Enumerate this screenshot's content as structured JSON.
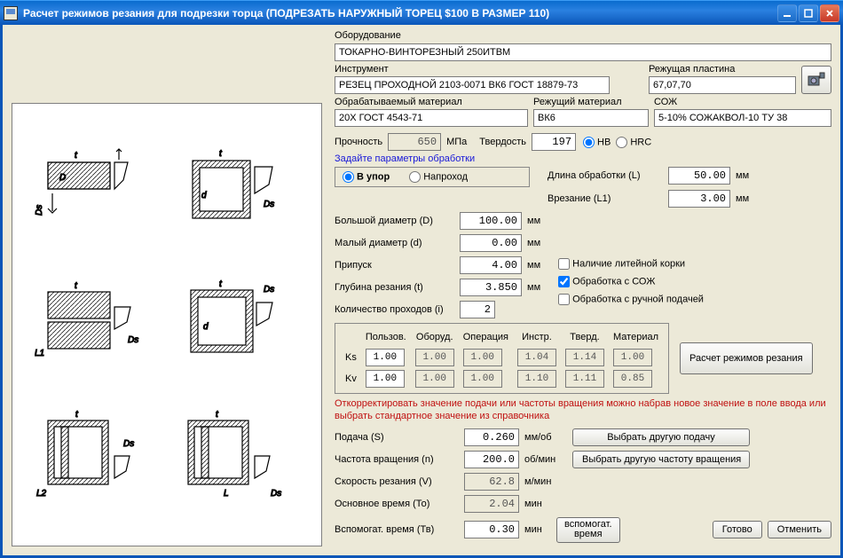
{
  "window": {
    "title": "Расчет режимов резания для подрезки торца (ПОДРЕЗАТЬ НАРУЖНЫЙ ТОРЕЦ  $100   В РАЗМЕР 110)"
  },
  "labels": {
    "equipment": "Оборудование",
    "tool": "Инструмент",
    "insert": "Режущая пластина",
    "work_material": "Обрабатываемый материал",
    "cut_material": "Режущий материал",
    "coolant": "СОЖ",
    "strength": "Прочность",
    "strength_unit": "МПа",
    "hardness": "Твердость",
    "hb": "HB",
    "hrc": "HRC",
    "set_params": "Задайте параметры обработки",
    "vupor": "В упор",
    "naprohod": "Напроход",
    "length": "Длина обработки (L)",
    "plunge": "Врезание  (L1)",
    "bigdia": "Большой диаметр (D)",
    "smalldia": "Малый диаметр (d)",
    "allowance": "Припуск",
    "depth": "Глубина резания (t)",
    "passes": "Количество проходов (i)",
    "casting_crust": "Наличие литейной корки",
    "with_coolant": "Обработка с СОЖ",
    "manual_feed": "Обработка с ручной подачей",
    "mm": "мм",
    "polzov": "Пользов.",
    "oborud": "Оборуд.",
    "operacia": "Операция",
    "instr": "Инстр.",
    "tverd": "Тверд.",
    "material": "Материал",
    "ks": "Ks",
    "kv": "Kv",
    "calc": "Расчет режимов резания",
    "note": "Откорректировать значение подачи или частоты вращения можно набрав новое значение в поле ввода или выбрать стандартное значение из справочника",
    "feed": "Подача (S)",
    "feed_unit": "мм/об",
    "rpm": "Частота вращения (n)",
    "rpm_unit": "об/мин",
    "speed": "Скорость резания (V)",
    "speed_unit": "м/мин",
    "t_main": "Основное время (То)",
    "t_aux": "Вспомогат. время (Тв)",
    "min": "мин",
    "sel_feed": "Выбрать другую подачу",
    "sel_rpm": "Выбрать другую частоту вращения",
    "aux_time_btn": "вспомогат.\nвремя",
    "done": "Готово",
    "cancel": "Отменить"
  },
  "values": {
    "equipment": "ТОКАРНО-ВИНТОРЕЗНЫЙ 250ИТВМ",
    "tool": "РЕЗЕЦ ПРОХОДНОЙ 2103-0071 ВК6 ГОСТ 18879-73",
    "insert": "67,07,70",
    "work_material": "20Х ГОСТ 4543-71",
    "cut_material": "ВК6",
    "coolant": "5-10% СОЖАКВОЛ-10 ТУ 38",
    "strength": "650",
    "hardness": "197",
    "length": "50.00",
    "plunge": "3.00",
    "bigdia": "100.00",
    "smalldia": "0.00",
    "allowance": "4.00",
    "depth": "3.850",
    "passes": "2",
    "ks": {
      "user": "1.00",
      "equip": "1.00",
      "oper": "1.00",
      "instr": "1.04",
      "hard": "1.14",
      "mat": "1.00"
    },
    "kv": {
      "user": "1.00",
      "equip": "1.00",
      "oper": "1.00",
      "instr": "1.10",
      "hard": "1.11",
      "mat": "0.85"
    },
    "feed": "0.260",
    "rpm": "200.0",
    "speed": "62.8",
    "t_main": "2.04",
    "t_aux": "0.30"
  }
}
